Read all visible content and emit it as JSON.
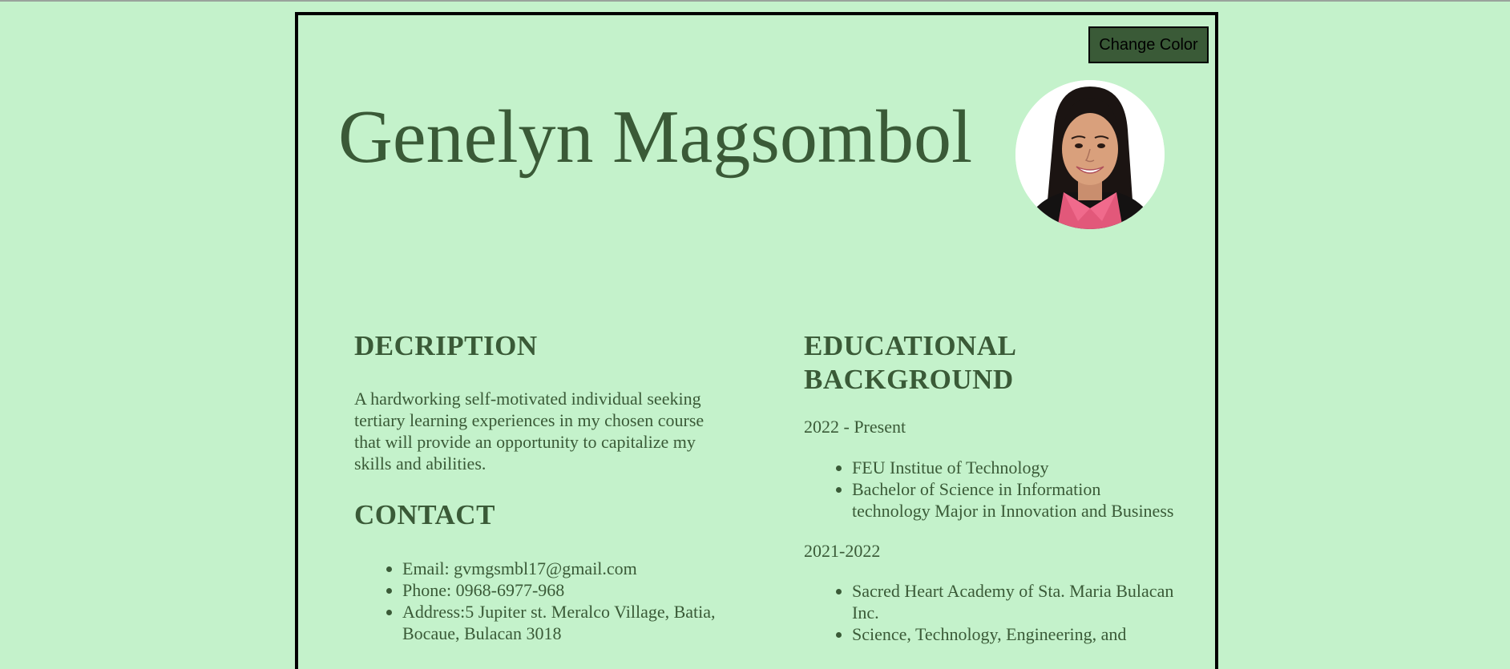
{
  "header": {
    "change_color_label": "Change Color",
    "name": "Genelyn Magsombol"
  },
  "description": {
    "heading": "DECRIPTION",
    "text": "A hardworking self-motivated individual seeking tertiary learning experiences in my chosen course that will provide an opportunity to capitalize my skills and abilities."
  },
  "contact": {
    "heading": "CONTACT",
    "items": [
      "Email: gvmgsmbl17@gmail.com",
      "Phone: 0968-6977-968",
      "Address:5 Jupiter st. Meralco Village, Batia, Bocaue, Bulacan 3018"
    ]
  },
  "education": {
    "heading_line1": "EDUCATIONAL",
    "heading_line2": "BACKGROUND",
    "periods": [
      {
        "years": "2022 - Present",
        "items": [
          "FEU Institue of Technology",
          "Bachelor of Science in Information technology Major in Innovation and Business"
        ]
      },
      {
        "years": "2021-2022",
        "items": [
          "Sacred Heart Academy of Sta. Maria Bulacan Inc.",
          "Science, Technology, Engineering, and"
        ]
      }
    ]
  },
  "colors": {
    "page_background": "#c4f2cb",
    "text_green": "#3a5a37",
    "button_background": "#3a5a37"
  },
  "icons": {
    "avatar": "profile-photo"
  }
}
